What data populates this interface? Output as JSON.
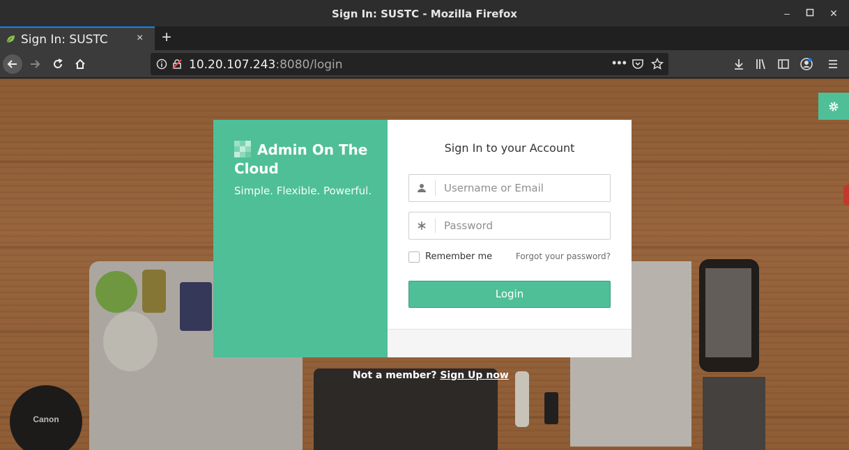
{
  "window": {
    "title": "Sign In: SUSTC - Mozilla Firefox"
  },
  "tab": {
    "label": "Sign In: SUSTC",
    "close": "×"
  },
  "newtab": "+",
  "urlbar": {
    "host": "10.20.107.243",
    "rest": ":8080/login"
  },
  "brand": {
    "title": "Admin On The Cloud",
    "tagline": "Simple. Flexible. Powerful."
  },
  "form": {
    "heading": "Sign In to your Account",
    "username_placeholder": "Username or Email",
    "password_placeholder": "Password",
    "remember_label": "Remember me",
    "forgot_label": "Forgot your password?",
    "login_label": "Login"
  },
  "signup": {
    "prompt": "Not a member?",
    "link": "Sign Up now"
  },
  "background": {
    "lens_cap_text": "Canon"
  },
  "colors": {
    "accent": "#4fbf98",
    "chrome_dark": "#2d2d2d",
    "tab_highlight": "#0a84ff"
  }
}
